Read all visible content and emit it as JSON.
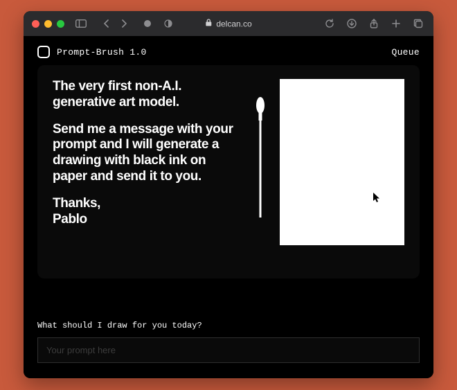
{
  "browser": {
    "url_host": "delcan.co"
  },
  "header": {
    "title": "Prompt-Brush 1.0",
    "queue_label": "Queue"
  },
  "hero": {
    "paragraph1": "The very first non-A.I. generative art model.",
    "paragraph2": "Send me a message with your prompt and I will generate a drawing with black ink on paper and send it to you.",
    "signoff1": "Thanks,",
    "signoff2": "Pablo"
  },
  "prompt": {
    "label": "What should I draw for you today?",
    "placeholder": "Your prompt here",
    "value": ""
  }
}
